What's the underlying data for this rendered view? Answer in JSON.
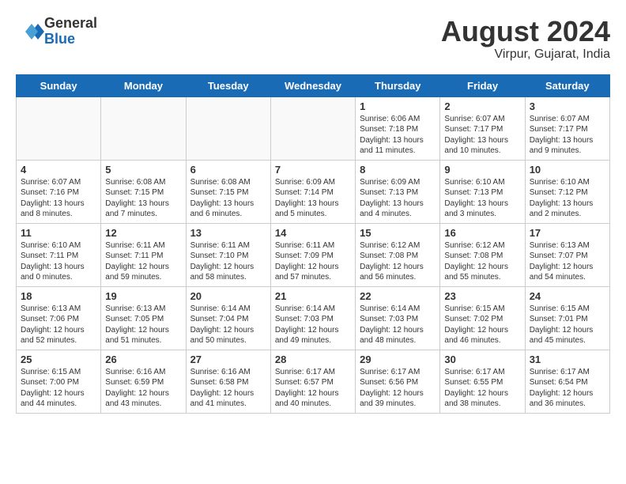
{
  "header": {
    "logo": {
      "general": "General",
      "blue": "Blue"
    },
    "month_year": "August 2024",
    "location": "Virpur, Gujarat, India"
  },
  "weekdays": [
    "Sunday",
    "Monday",
    "Tuesday",
    "Wednesday",
    "Thursday",
    "Friday",
    "Saturday"
  ],
  "weeks": [
    [
      {
        "day": "",
        "info": ""
      },
      {
        "day": "",
        "info": ""
      },
      {
        "day": "",
        "info": ""
      },
      {
        "day": "",
        "info": ""
      },
      {
        "day": "1",
        "info": "Sunrise: 6:06 AM\nSunset: 7:18 PM\nDaylight: 13 hours\nand 11 minutes."
      },
      {
        "day": "2",
        "info": "Sunrise: 6:07 AM\nSunset: 7:17 PM\nDaylight: 13 hours\nand 10 minutes."
      },
      {
        "day": "3",
        "info": "Sunrise: 6:07 AM\nSunset: 7:17 PM\nDaylight: 13 hours\nand 9 minutes."
      }
    ],
    [
      {
        "day": "4",
        "info": "Sunrise: 6:07 AM\nSunset: 7:16 PM\nDaylight: 13 hours\nand 8 minutes."
      },
      {
        "day": "5",
        "info": "Sunrise: 6:08 AM\nSunset: 7:15 PM\nDaylight: 13 hours\nand 7 minutes."
      },
      {
        "day": "6",
        "info": "Sunrise: 6:08 AM\nSunset: 7:15 PM\nDaylight: 13 hours\nand 6 minutes."
      },
      {
        "day": "7",
        "info": "Sunrise: 6:09 AM\nSunset: 7:14 PM\nDaylight: 13 hours\nand 5 minutes."
      },
      {
        "day": "8",
        "info": "Sunrise: 6:09 AM\nSunset: 7:13 PM\nDaylight: 13 hours\nand 4 minutes."
      },
      {
        "day": "9",
        "info": "Sunrise: 6:10 AM\nSunset: 7:13 PM\nDaylight: 13 hours\nand 3 minutes."
      },
      {
        "day": "10",
        "info": "Sunrise: 6:10 AM\nSunset: 7:12 PM\nDaylight: 13 hours\nand 2 minutes."
      }
    ],
    [
      {
        "day": "11",
        "info": "Sunrise: 6:10 AM\nSunset: 7:11 PM\nDaylight: 13 hours\nand 0 minutes."
      },
      {
        "day": "12",
        "info": "Sunrise: 6:11 AM\nSunset: 7:11 PM\nDaylight: 12 hours\nand 59 minutes."
      },
      {
        "day": "13",
        "info": "Sunrise: 6:11 AM\nSunset: 7:10 PM\nDaylight: 12 hours\nand 58 minutes."
      },
      {
        "day": "14",
        "info": "Sunrise: 6:11 AM\nSunset: 7:09 PM\nDaylight: 12 hours\nand 57 minutes."
      },
      {
        "day": "15",
        "info": "Sunrise: 6:12 AM\nSunset: 7:08 PM\nDaylight: 12 hours\nand 56 minutes."
      },
      {
        "day": "16",
        "info": "Sunrise: 6:12 AM\nSunset: 7:08 PM\nDaylight: 12 hours\nand 55 minutes."
      },
      {
        "day": "17",
        "info": "Sunrise: 6:13 AM\nSunset: 7:07 PM\nDaylight: 12 hours\nand 54 minutes."
      }
    ],
    [
      {
        "day": "18",
        "info": "Sunrise: 6:13 AM\nSunset: 7:06 PM\nDaylight: 12 hours\nand 52 minutes."
      },
      {
        "day": "19",
        "info": "Sunrise: 6:13 AM\nSunset: 7:05 PM\nDaylight: 12 hours\nand 51 minutes."
      },
      {
        "day": "20",
        "info": "Sunrise: 6:14 AM\nSunset: 7:04 PM\nDaylight: 12 hours\nand 50 minutes."
      },
      {
        "day": "21",
        "info": "Sunrise: 6:14 AM\nSunset: 7:03 PM\nDaylight: 12 hours\nand 49 minutes."
      },
      {
        "day": "22",
        "info": "Sunrise: 6:14 AM\nSunset: 7:03 PM\nDaylight: 12 hours\nand 48 minutes."
      },
      {
        "day": "23",
        "info": "Sunrise: 6:15 AM\nSunset: 7:02 PM\nDaylight: 12 hours\nand 46 minutes."
      },
      {
        "day": "24",
        "info": "Sunrise: 6:15 AM\nSunset: 7:01 PM\nDaylight: 12 hours\nand 45 minutes."
      }
    ],
    [
      {
        "day": "25",
        "info": "Sunrise: 6:15 AM\nSunset: 7:00 PM\nDaylight: 12 hours\nand 44 minutes."
      },
      {
        "day": "26",
        "info": "Sunrise: 6:16 AM\nSunset: 6:59 PM\nDaylight: 12 hours\nand 43 minutes."
      },
      {
        "day": "27",
        "info": "Sunrise: 6:16 AM\nSunset: 6:58 PM\nDaylight: 12 hours\nand 41 minutes."
      },
      {
        "day": "28",
        "info": "Sunrise: 6:17 AM\nSunset: 6:57 PM\nDaylight: 12 hours\nand 40 minutes."
      },
      {
        "day": "29",
        "info": "Sunrise: 6:17 AM\nSunset: 6:56 PM\nDaylight: 12 hours\nand 39 minutes."
      },
      {
        "day": "30",
        "info": "Sunrise: 6:17 AM\nSunset: 6:55 PM\nDaylight: 12 hours\nand 38 minutes."
      },
      {
        "day": "31",
        "info": "Sunrise: 6:17 AM\nSunset: 6:54 PM\nDaylight: 12 hours\nand 36 minutes."
      }
    ]
  ]
}
